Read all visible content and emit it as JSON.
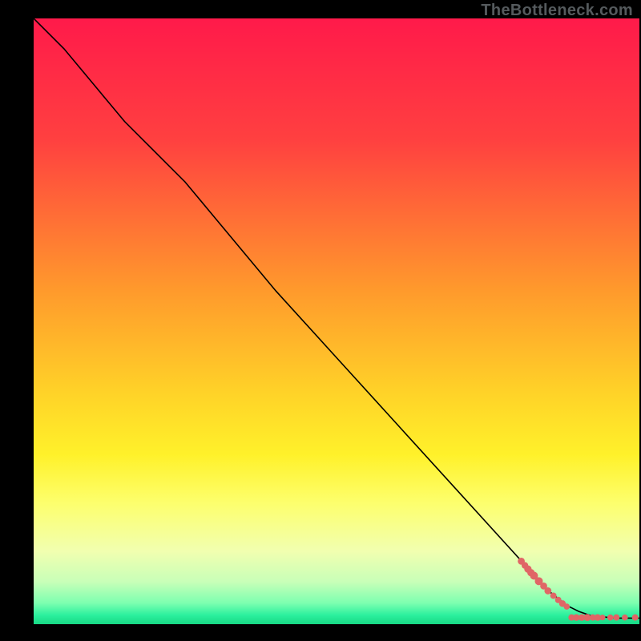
{
  "watermark": "TheBottleneck.com",
  "chart_data": {
    "type": "line",
    "title": "",
    "xlabel": "",
    "ylabel": "",
    "xlim": [
      0,
      100
    ],
    "ylim": [
      0,
      100
    ],
    "gradient": {
      "comment": "vertical background gradient inside plot, top=red → mid=yellow → bottom=green",
      "stops": [
        {
          "offset": 0.0,
          "color": "#ff1a4a"
        },
        {
          "offset": 0.2,
          "color": "#ff4040"
        },
        {
          "offset": 0.45,
          "color": "#ff9a2c"
        },
        {
          "offset": 0.62,
          "color": "#ffd328"
        },
        {
          "offset": 0.72,
          "color": "#fff12a"
        },
        {
          "offset": 0.8,
          "color": "#fdff6d"
        },
        {
          "offset": 0.88,
          "color": "#f1ffb0"
        },
        {
          "offset": 0.93,
          "color": "#c8ffb8"
        },
        {
          "offset": 0.965,
          "color": "#7dffb0"
        },
        {
          "offset": 0.985,
          "color": "#2cf09e"
        },
        {
          "offset": 1.0,
          "color": "#17d884"
        }
      ]
    },
    "series": [
      {
        "name": "curve",
        "comment": "black line; x,y in chart coords (y up). Starts top-left, bends ~25%, ends bottom-right.",
        "x": [
          0,
          5,
          10,
          15,
          20,
          25,
          30,
          40,
          50,
          60,
          70,
          80,
          85,
          88,
          90,
          92,
          96,
          100
        ],
        "y": [
          100,
          95,
          89,
          83,
          78,
          73,
          67,
          55,
          44,
          33,
          22,
          11,
          5.5,
          3.1,
          2.1,
          1.4,
          1.0,
          1.0
        ],
        "color": "#000000",
        "stroke_width": 1.6
      },
      {
        "name": "scatter-on-line",
        "comment": "salmon dots riding the line near the bottom-right elbow",
        "type": "scatter",
        "points": [
          {
            "x": 80.5,
            "y": 10.4,
            "r": 4.4
          },
          {
            "x": 81.1,
            "y": 9.7,
            "r": 4.2
          },
          {
            "x": 81.6,
            "y": 9.1,
            "r": 4.6
          },
          {
            "x": 82.1,
            "y": 8.5,
            "r": 4.6
          },
          {
            "x": 82.6,
            "y": 8.0,
            "r": 5.0
          },
          {
            "x": 83.4,
            "y": 7.1,
            "r": 5.0
          },
          {
            "x": 84.2,
            "y": 6.3,
            "r": 4.4
          },
          {
            "x": 84.9,
            "y": 5.5,
            "r": 4.4
          },
          {
            "x": 85.8,
            "y": 4.7,
            "r": 4.0
          },
          {
            "x": 86.6,
            "y": 4.0,
            "r": 4.0
          },
          {
            "x": 87.3,
            "y": 3.4,
            "r": 4.2
          },
          {
            "x": 88.0,
            "y": 2.9,
            "r": 3.8
          }
        ],
        "color": "#e06666"
      },
      {
        "name": "scatter-baseline",
        "comment": "salmon dots along y≈1 near the right edge",
        "type": "scatter",
        "points": [
          {
            "x": 88.8,
            "y": 1.1,
            "r": 4.0
          },
          {
            "x": 89.6,
            "y": 1.1,
            "r": 4.2
          },
          {
            "x": 90.5,
            "y": 1.1,
            "r": 4.2
          },
          {
            "x": 91.4,
            "y": 1.1,
            "r": 4.4
          },
          {
            "x": 92.3,
            "y": 1.1,
            "r": 4.0
          },
          {
            "x": 93.1,
            "y": 1.1,
            "r": 4.2
          },
          {
            "x": 93.9,
            "y": 1.1,
            "r": 3.6
          },
          {
            "x": 95.2,
            "y": 1.1,
            "r": 3.8
          },
          {
            "x": 96.2,
            "y": 1.1,
            "r": 4.0
          },
          {
            "x": 97.6,
            "y": 1.1,
            "r": 3.8
          },
          {
            "x": 99.3,
            "y": 1.1,
            "r": 4.0
          }
        ],
        "color": "#e06666"
      }
    ]
  }
}
